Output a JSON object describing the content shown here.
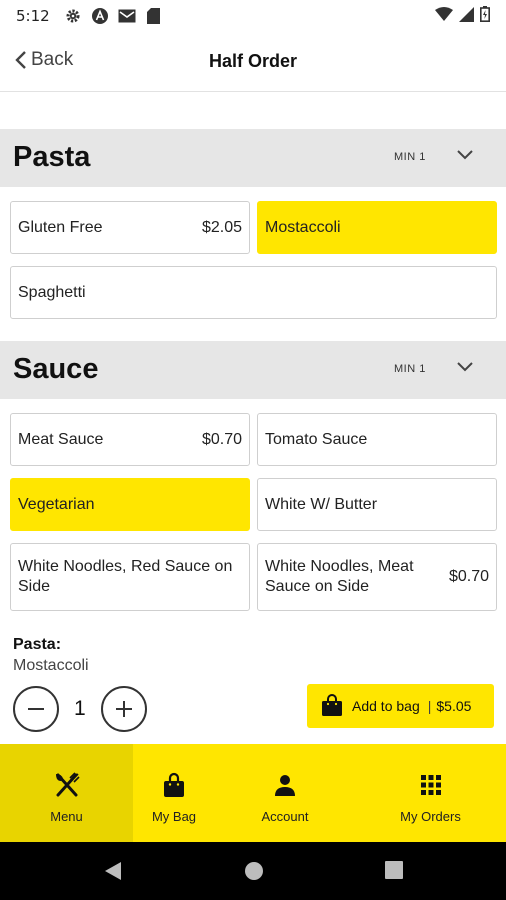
{
  "status_bar": {
    "time": "5:12",
    "icons": [
      "settings-icon",
      "assistant-icon",
      "mail-icon",
      "sd-card-icon",
      "wifi-icon",
      "signal-icon",
      "battery-icon"
    ]
  },
  "header": {
    "back_label": "Back",
    "title": "Half Order"
  },
  "sections": [
    {
      "name": "Pasta",
      "min_label": "MIN 1",
      "options": [
        {
          "label": "Gluten Free",
          "price": "$2.05",
          "selected": false
        },
        {
          "label": "Mostaccoli",
          "price": "",
          "selected": true
        },
        {
          "label": "Spaghetti",
          "price": "",
          "selected": false
        }
      ]
    },
    {
      "name": "Sauce",
      "min_label": "MIN 1",
      "options": [
        {
          "label": "Meat Sauce",
          "price": "$0.70",
          "selected": false
        },
        {
          "label": "Tomato Sauce",
          "price": "",
          "selected": false
        },
        {
          "label": "Vegetarian",
          "price": "",
          "selected": true
        },
        {
          "label": "White W/ Butter",
          "price": "",
          "selected": false
        },
        {
          "label": "White Noodles, Red Sauce on Side",
          "price": "",
          "selected": false
        },
        {
          "label": "White Noodles, Meat Sauce on Side",
          "price": "$0.70",
          "selected": false
        }
      ]
    }
  ],
  "summary": {
    "heading": "Pasta:",
    "value": "Mostaccoli"
  },
  "quantity": {
    "value": "1"
  },
  "add_to_bag": {
    "label": "Add to bag",
    "separator": "|",
    "price": "$5.05"
  },
  "tabs": [
    {
      "label": "Menu",
      "icon": "fork-knife-icon",
      "active": true
    },
    {
      "label": "My Bag",
      "icon": "bag-icon",
      "active": false
    },
    {
      "label": "Account",
      "icon": "person-icon",
      "active": false
    },
    {
      "label": "My Orders",
      "icon": "grid-icon",
      "active": false
    }
  ],
  "colors": {
    "accent": "#ffe600",
    "accent_dark": "#e8d400",
    "section_bg": "#e6e6e6"
  }
}
